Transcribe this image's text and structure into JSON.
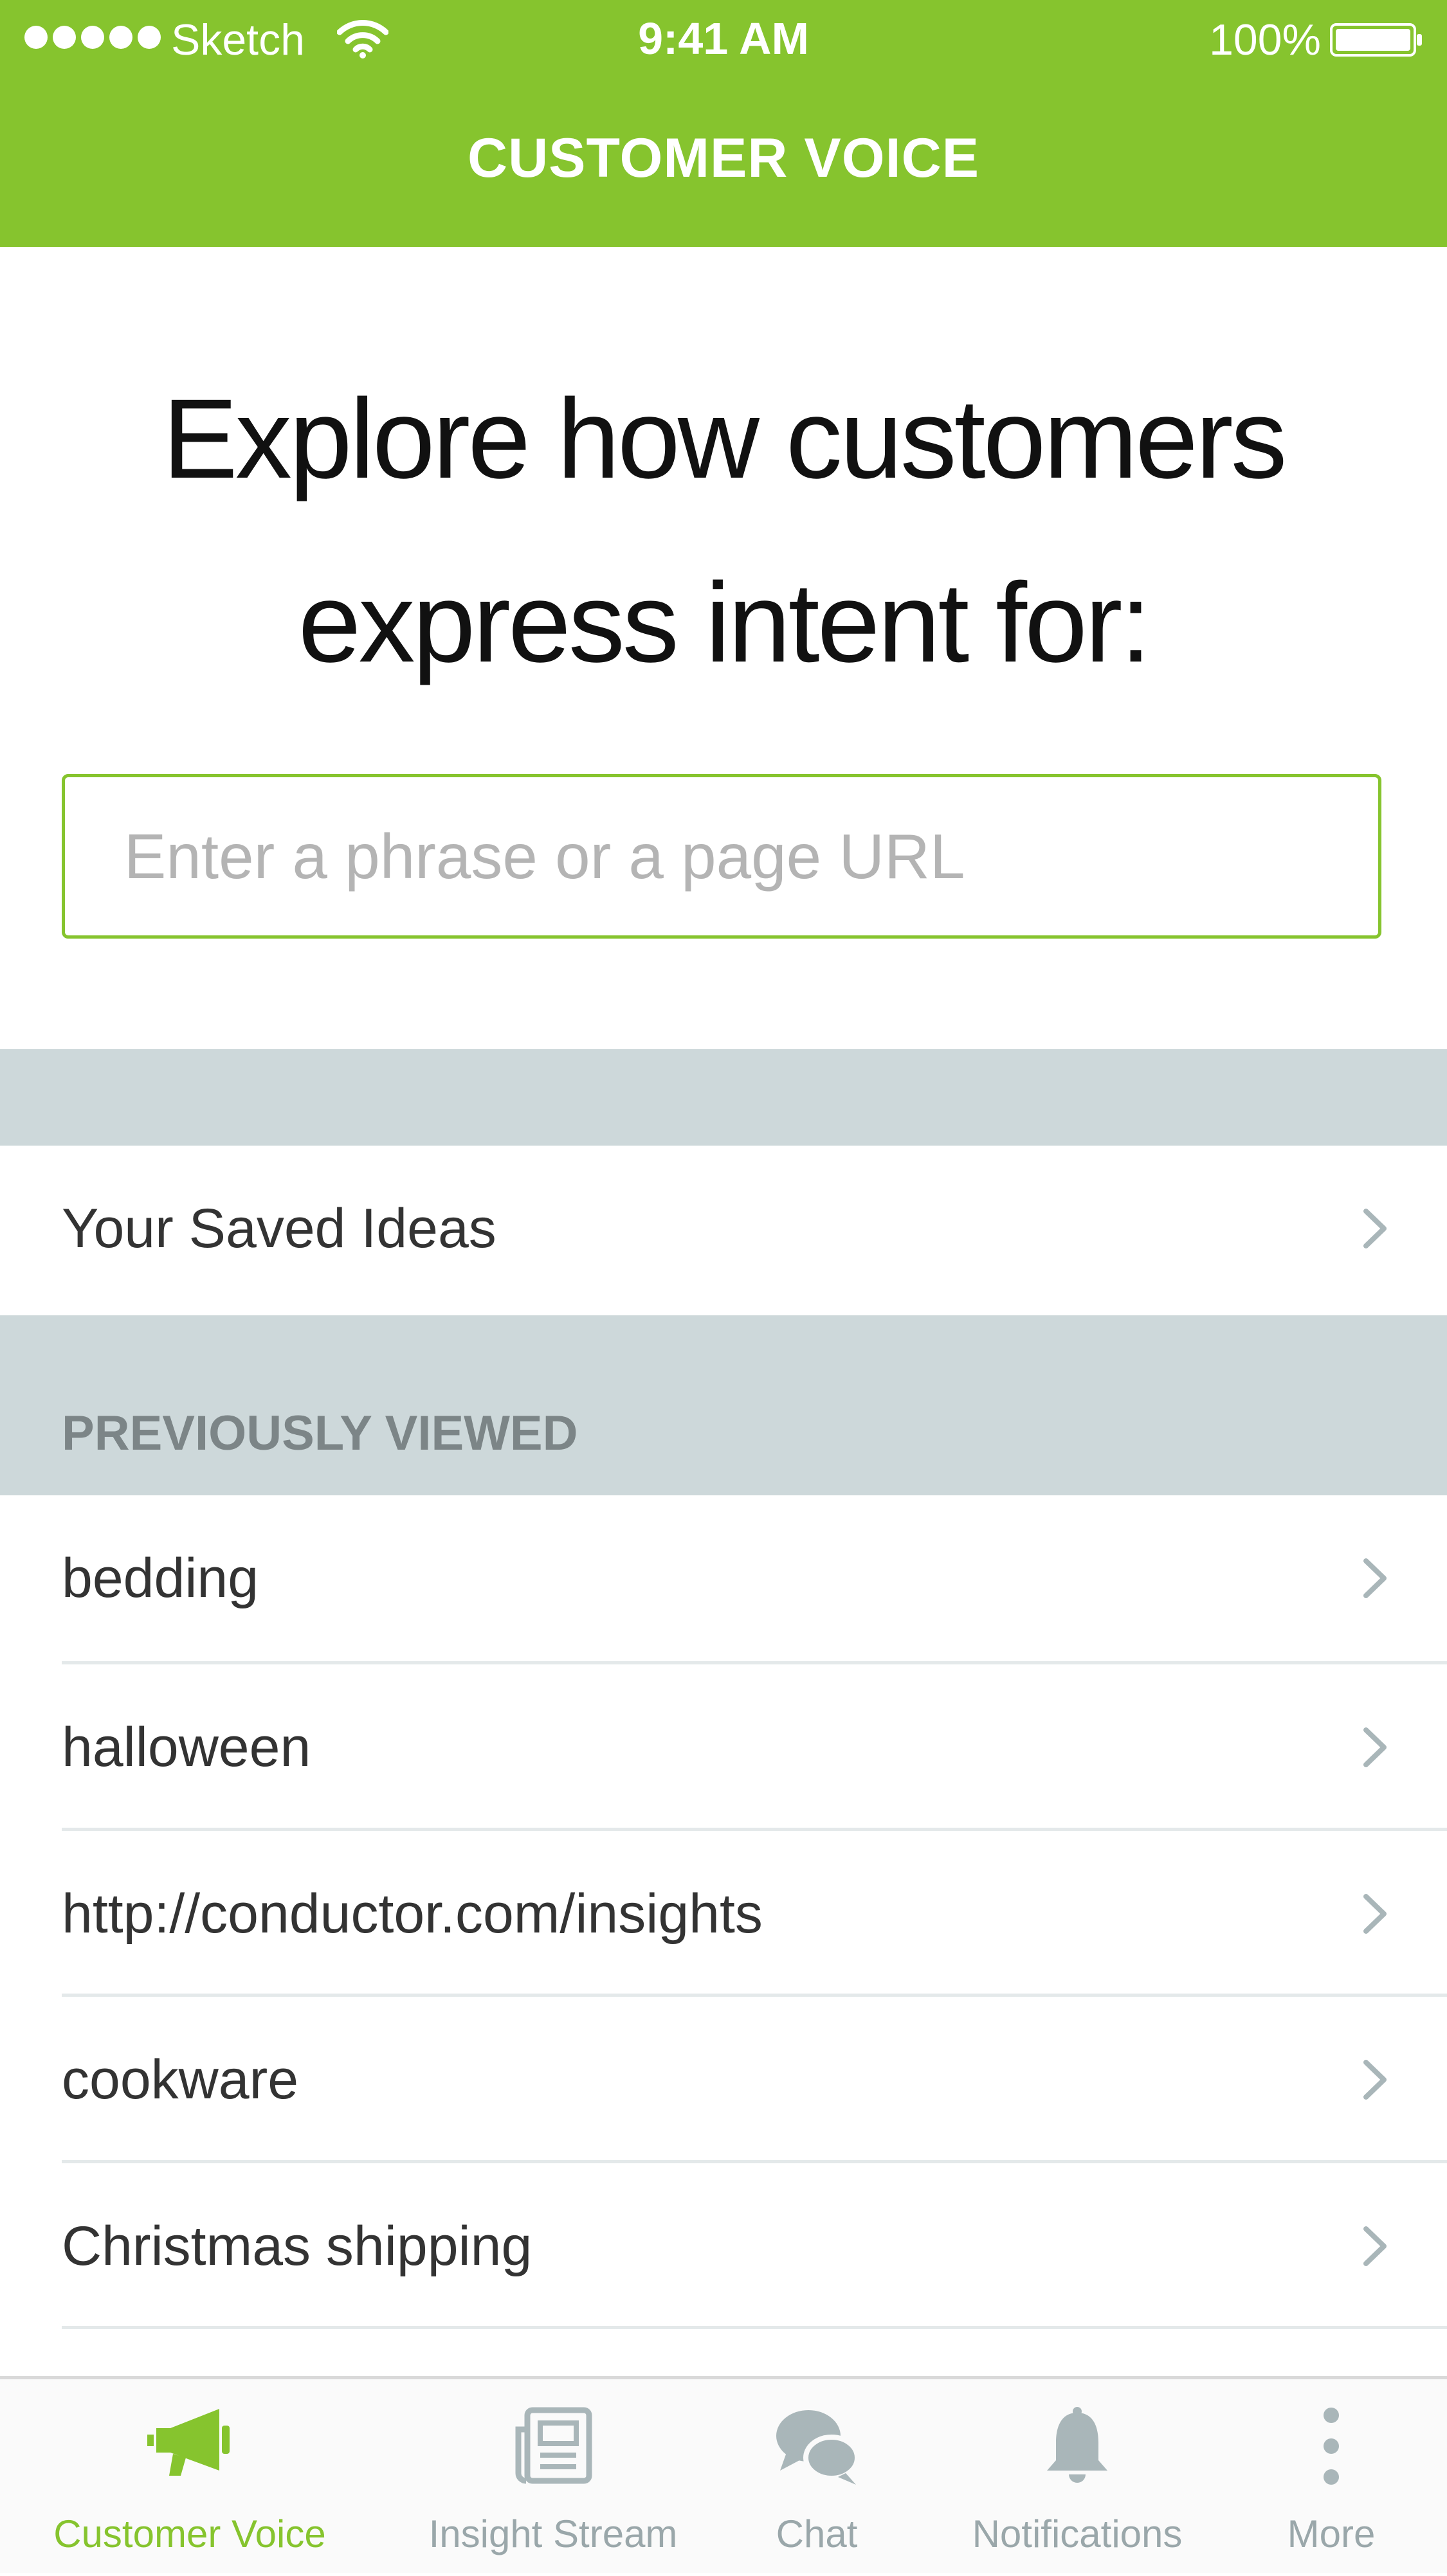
{
  "status_bar": {
    "carrier": "Sketch",
    "time": "9:41 AM",
    "battery": "100%"
  },
  "header": {
    "title": "CUSTOMER VOICE"
  },
  "hero": {
    "line1": "Explore how customers",
    "line2": "express intent for:"
  },
  "search": {
    "placeholder": "Enter a phrase or a page URL",
    "value": ""
  },
  "saved": {
    "label": "Your Saved Ideas"
  },
  "previously_viewed": {
    "heading": "PREVIOUSLY VIEWED",
    "items": [
      "bedding",
      "halloween",
      "http://conductor.com/insights",
      "cookware",
      "Christmas shipping"
    ]
  },
  "tab_bar": {
    "tabs": [
      {
        "label": "Customer Voice",
        "icon": "megaphone-icon",
        "active": true
      },
      {
        "label": "Insight Stream",
        "icon": "newspaper-icon",
        "active": false
      },
      {
        "label": "Chat",
        "icon": "chat-bubbles-icon",
        "active": false
      },
      {
        "label": "Notifications",
        "icon": "bell-icon",
        "active": false
      },
      {
        "label": "More",
        "icon": "more-dots-icon",
        "active": false
      }
    ]
  },
  "colors": {
    "accent": "#86c42e",
    "section_gray": "#cdd8da",
    "inactive_tab": "#9aa7aa"
  }
}
